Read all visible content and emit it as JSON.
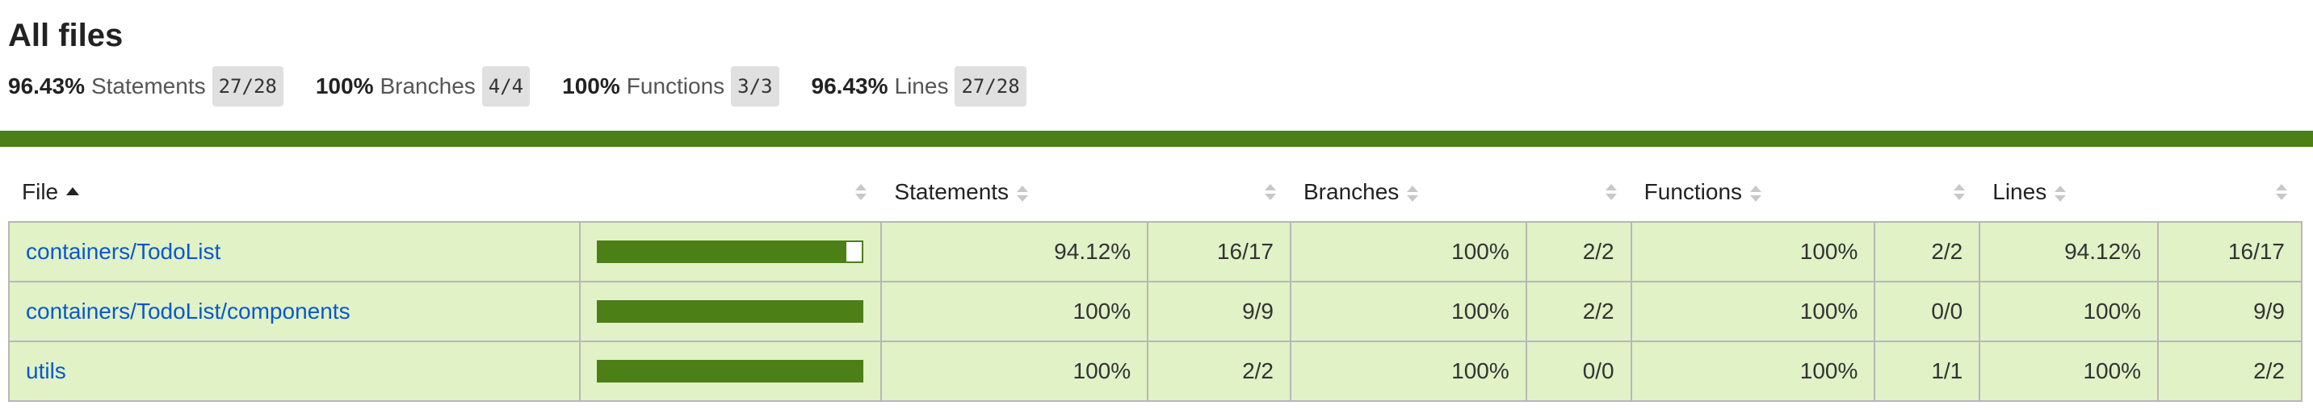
{
  "page": {
    "title": "All files"
  },
  "summary": [
    {
      "pct": "96.43%",
      "label": "Statements",
      "fraction": "27/28"
    },
    {
      "pct": "100%",
      "label": "Branches",
      "fraction": "4/4"
    },
    {
      "pct": "100%",
      "label": "Functions",
      "fraction": "3/3"
    },
    {
      "pct": "96.43%",
      "label": "Lines",
      "fraction": "27/28"
    }
  ],
  "colors": {
    "status_high": "#4d7f17",
    "row_high_bg": "#e0f2c6",
    "link": "#0a58ca"
  },
  "table": {
    "headers": {
      "file": "File",
      "statements": "Statements",
      "branches": "Branches",
      "functions": "Functions",
      "lines": "Lines"
    },
    "sort": {
      "column": "File",
      "direction": "ascending"
    },
    "rows": [
      {
        "file": "containers/TodoList",
        "coverage": 0.9412,
        "statements_pct": "94.12%",
        "statements_frac": "16/17",
        "branches_pct": "100%",
        "branches_frac": "2/2",
        "functions_pct": "100%",
        "functions_frac": "2/2",
        "lines_pct": "94.12%",
        "lines_frac": "16/17"
      },
      {
        "file": "containers/TodoList/components",
        "coverage": 1.0,
        "statements_pct": "100%",
        "statements_frac": "9/9",
        "branches_pct": "100%",
        "branches_frac": "2/2",
        "functions_pct": "100%",
        "functions_frac": "0/0",
        "lines_pct": "100%",
        "lines_frac": "9/9"
      },
      {
        "file": "utils",
        "coverage": 1.0,
        "statements_pct": "100%",
        "statements_frac": "2/2",
        "branches_pct": "100%",
        "branches_frac": "0/0",
        "functions_pct": "100%",
        "functions_frac": "1/1",
        "lines_pct": "100%",
        "lines_frac": "2/2"
      }
    ]
  }
}
